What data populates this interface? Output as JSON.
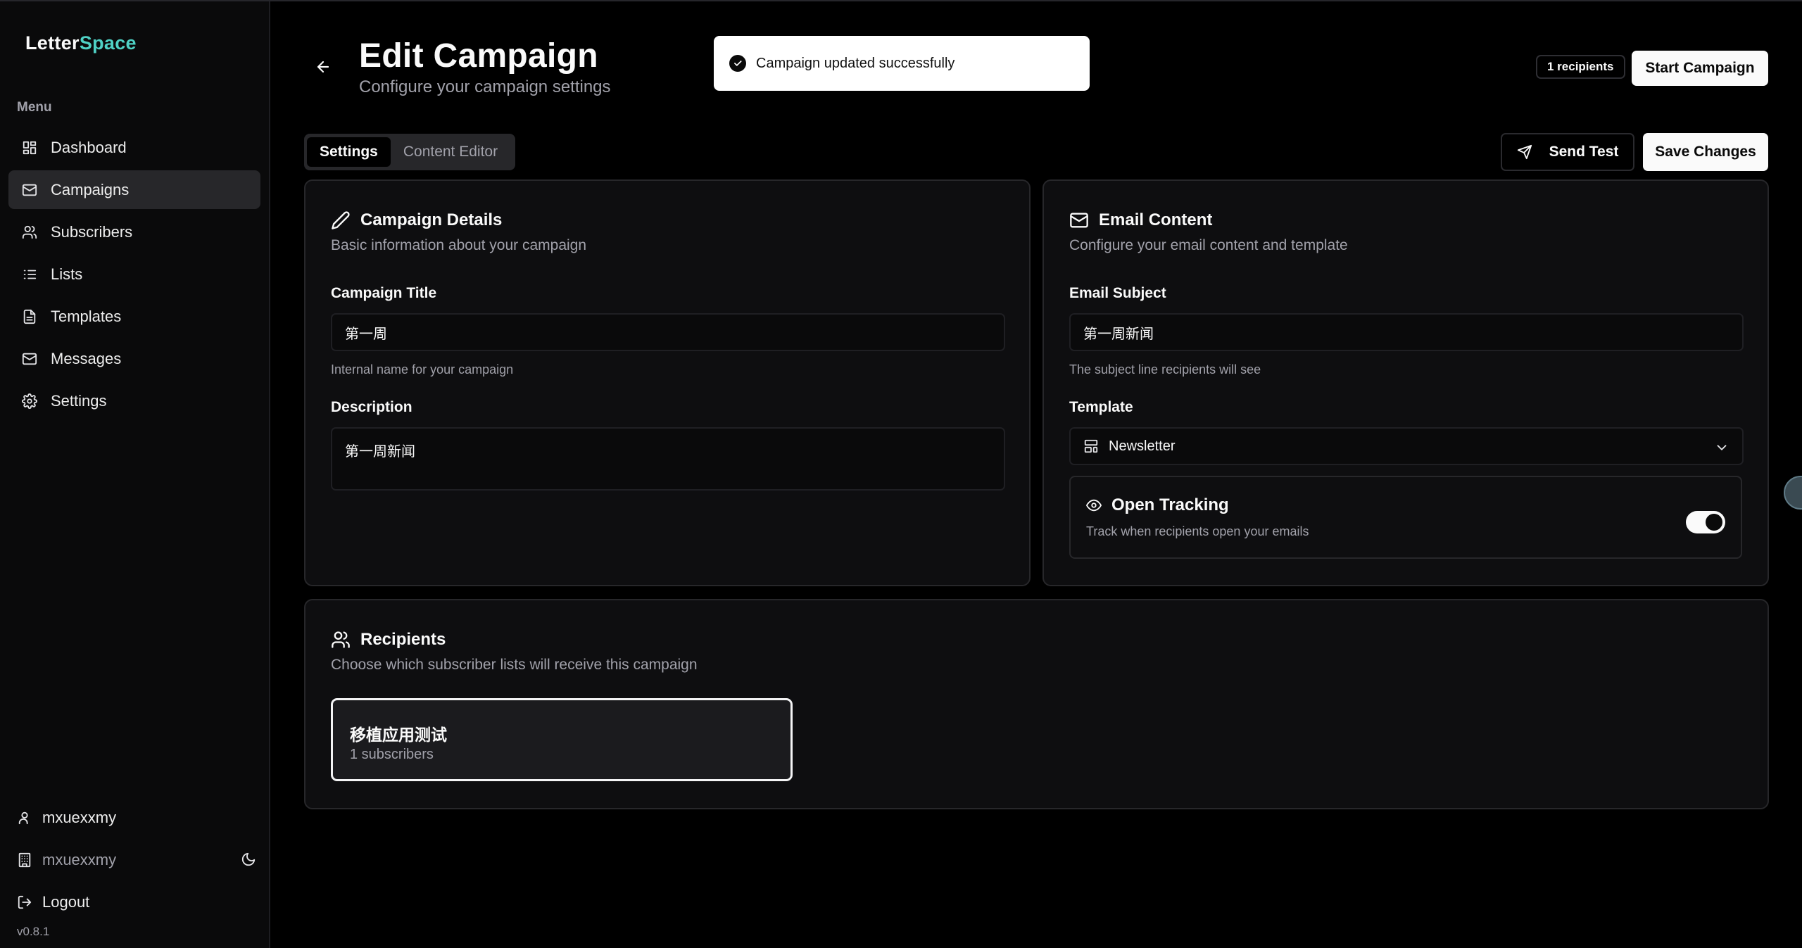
{
  "app": {
    "logo_part1": "Letter",
    "logo_part2": "Space",
    "version": "v0.8.1"
  },
  "sidebar": {
    "menu_label": "Menu",
    "items": [
      {
        "label": "Dashboard",
        "icon": "dashboard-icon"
      },
      {
        "label": "Campaigns",
        "icon": "mail-icon",
        "active": true
      },
      {
        "label": "Subscribers",
        "icon": "users-icon"
      },
      {
        "label": "Lists",
        "icon": "list-icon"
      },
      {
        "label": "Templates",
        "icon": "file-text-icon"
      },
      {
        "label": "Messages",
        "icon": "mail-icon"
      },
      {
        "label": "Settings",
        "icon": "gear-icon"
      }
    ],
    "user_name": "mxuexxmy",
    "org_name": "mxuexxmy",
    "logout_label": "Logout"
  },
  "header": {
    "title": "Edit Campaign",
    "subtitle": "Configure your campaign settings",
    "recipients_badge": "1 recipients",
    "start_campaign_label": "Start Campaign"
  },
  "toast": {
    "message": "Campaign updated successfully"
  },
  "tabs": [
    {
      "label": "Settings",
      "active": true
    },
    {
      "label": "Content Editor",
      "active": false
    }
  ],
  "actions": {
    "send_test_label": "Send Test",
    "save_changes_label": "Save Changes"
  },
  "campaign_details": {
    "title": "Campaign Details",
    "description": "Basic information about your campaign",
    "campaign_title_label": "Campaign Title",
    "campaign_title_value": "第一周",
    "campaign_title_hint": "Internal name for your campaign",
    "description_label": "Description",
    "description_value": "第一周新闻"
  },
  "email_content": {
    "title": "Email Content",
    "description": "Configure your email content and template",
    "subject_label": "Email Subject",
    "subject_value": "第一周新闻",
    "subject_hint": "The subject line recipients will see",
    "template_label": "Template",
    "template_value": "Newsletter",
    "open_tracking_title": "Open Tracking",
    "open_tracking_desc": "Track when recipients open your emails",
    "open_tracking_enabled": true
  },
  "recipients": {
    "title": "Recipients",
    "description": "Choose which subscriber lists will receive this campaign",
    "lists": [
      {
        "name": "移植应用测试",
        "count": "1 subscribers",
        "selected": true
      }
    ]
  },
  "colors": {
    "accent": "#4fd1c5",
    "background": "#000000",
    "card": "#0e0e10",
    "border": "#27272a"
  }
}
